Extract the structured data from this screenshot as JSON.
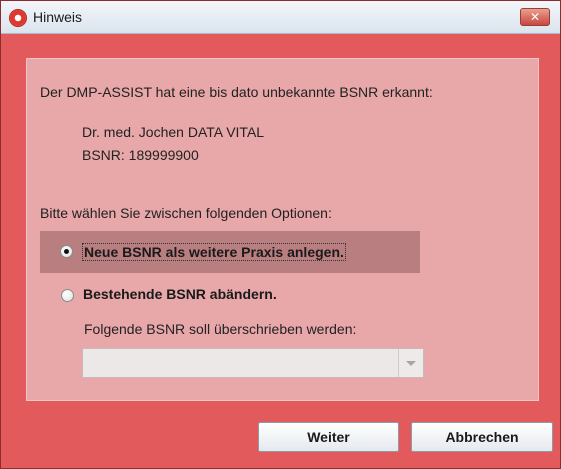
{
  "window": {
    "title": "Hinweis",
    "close_icon": "close-icon"
  },
  "content": {
    "intro": "Der DMP-ASSIST hat eine bis dato unbekannte BSNR erkannt:",
    "doctor": "Dr. med. Jochen DATA VITAL",
    "bsnr": "BSNR: 189999900",
    "prompt": "Bitte wählen Sie zwischen folgenden Optionen:",
    "options": [
      {
        "label": "Neue BSNR als weitere Praxis anlegen.",
        "selected": true
      },
      {
        "label": "Bestehende BSNR abändern.",
        "selected": false
      }
    ],
    "overwrite_label": "Folgende BSNR soll überschrieben werden:",
    "overwrite_value": ""
  },
  "buttons": {
    "next": "Weiter",
    "cancel": "Abbrechen"
  },
  "colors": {
    "window_background": "#e35a5c",
    "panel_background": "#e8a7a8",
    "selected_option_background": "#b97e7f"
  }
}
